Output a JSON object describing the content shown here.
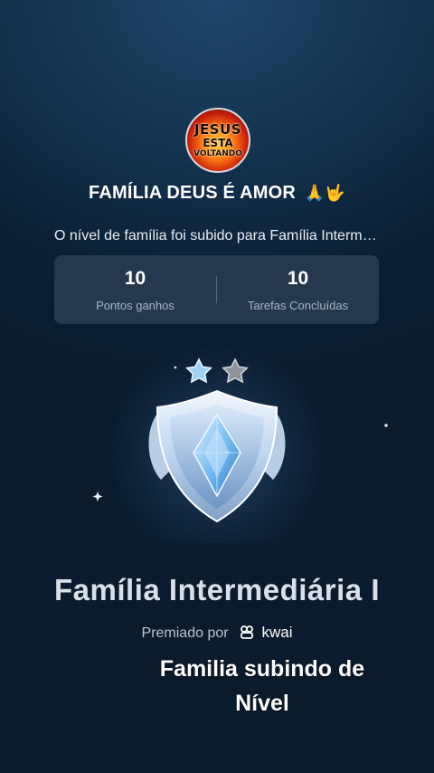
{
  "avatar": {
    "line1": "JESUS",
    "line2": "ESTA",
    "line3": "VOLTANDO"
  },
  "family_name": "FAMÍLIA DEUS É AMOR",
  "family_emojis": "🙏🤟",
  "level_message": "O nível de família foi subido para Família Intermediária I",
  "stats": [
    {
      "value": "10",
      "label": "Pontos ganhos"
    },
    {
      "value": "10",
      "label": "Tarefas Concluídas"
    }
  ],
  "badge": {
    "stars_filled": 1,
    "stars_total": 2,
    "icon": "shield-crystal-icon"
  },
  "level_name": "Família Intermediária I",
  "award": {
    "prefix": "Premiado por",
    "brand": "kwai"
  },
  "caption": "Familia subindo de Nível"
}
